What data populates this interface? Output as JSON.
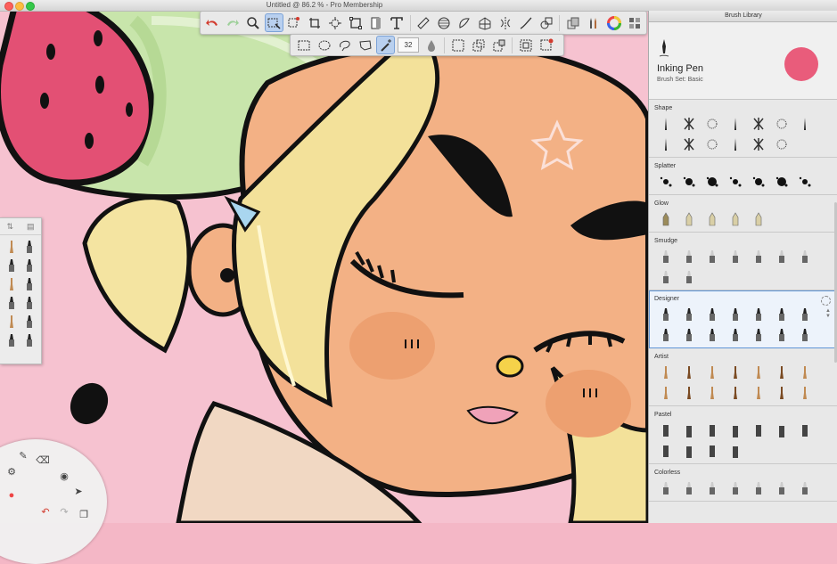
{
  "window": {
    "title": "Untitled @ 86.2 % - Pro Membership"
  },
  "toolbar": {
    "tools": [
      "undo-icon",
      "redo-icon",
      "zoom-icon",
      "select-rect-icon",
      "crop-icon",
      "transform-icon",
      "perspective-icon",
      "layer-copy-icon",
      "text-icon",
      "ruler-icon",
      "ellipse-guide-icon",
      "french-curve-icon",
      "perspective-grid-icon",
      "symmetry-icon",
      "steady-stroke-icon",
      "shape-icon",
      "copic-icon",
      "brush-library-icon",
      "color-wheel-icon",
      "layers-icon"
    ],
    "brush_size": "32"
  },
  "brush_library": {
    "panel_title": "Brush Library",
    "current_brush": {
      "name": "Inking Pen",
      "set": "Brush Set: Basic",
      "color": "#e95c7b"
    },
    "sections": [
      {
        "title": "Shape",
        "rows": [
          7,
          6
        ]
      },
      {
        "title": "Splatter",
        "rows": [
          7
        ]
      },
      {
        "title": "Glow",
        "rows": [
          5
        ]
      },
      {
        "title": "Smudge",
        "rows": [
          7,
          2
        ]
      },
      {
        "title": "Designer",
        "rows": [
          7,
          7
        ],
        "selected": true
      },
      {
        "title": "Artist",
        "rows": [
          7,
          7
        ]
      },
      {
        "title": "Pastel",
        "rows": [
          7,
          4
        ]
      },
      {
        "title": "Colorless",
        "rows": [
          7
        ]
      }
    ]
  },
  "colors": {
    "accent": "#e95c7b",
    "selection": "#5f95d6",
    "skin": "#f3b185",
    "hair": "#f2e29b",
    "hat": "#bfe0a0",
    "background": "#f6c2d0"
  }
}
